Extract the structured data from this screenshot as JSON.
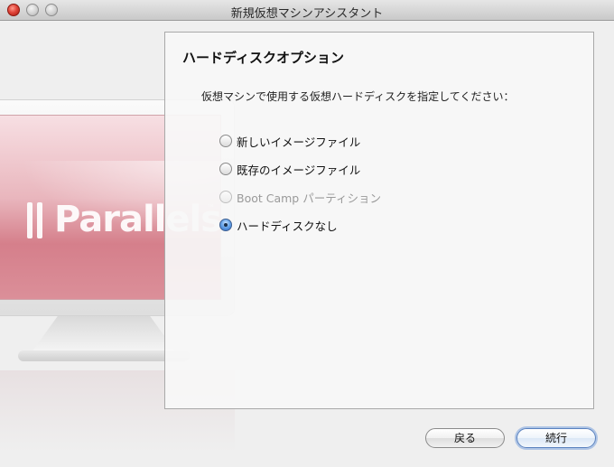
{
  "window": {
    "title": "新規仮想マシンアシスタント"
  },
  "brand": {
    "logo_text": "Parallels",
    "trademark": "™"
  },
  "panel": {
    "heading": "ハードディスクオプション",
    "instruction": "仮想マシンで使用する仮想ハードディスクを指定してください：",
    "options": [
      {
        "label": "新しいイメージファイル",
        "selected": false,
        "enabled": true
      },
      {
        "label": "既存のイメージファイル",
        "selected": false,
        "enabled": true
      },
      {
        "label": "Boot Camp パーティション",
        "selected": false,
        "enabled": false
      },
      {
        "label": "ハードディスクなし",
        "selected": true,
        "enabled": true
      }
    ]
  },
  "buttons": {
    "back": "戻る",
    "continue": "続行"
  },
  "colors": {
    "accent": "#3d7ad6",
    "screen_pink": "#d57f8b"
  }
}
